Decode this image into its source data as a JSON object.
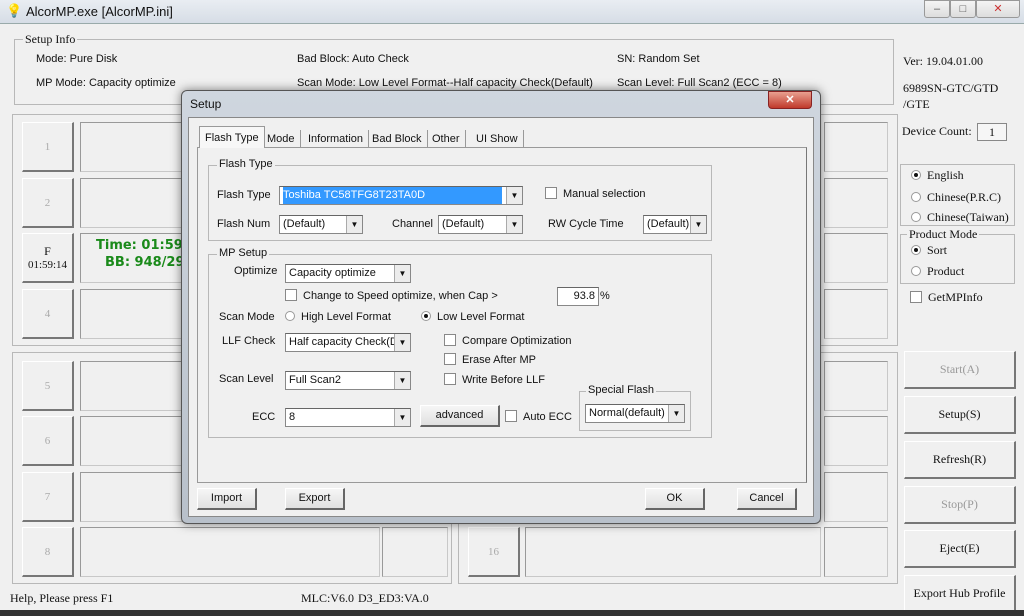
{
  "window": {
    "title": "AlcorMP.exe [AlcorMP.ini]",
    "minimize": "–",
    "maximize": "□",
    "close": "✕",
    "app_icon": "lightbulb-icon"
  },
  "setup_info": {
    "label": "Setup Info",
    "mode": "Mode: Pure Disk",
    "mp_mode": "MP Mode: Capacity optimize",
    "bad_block": "Bad Block: Auto Check",
    "scan_mode": "Scan Mode: Low Level Format--Half capacity Check(Default)",
    "sn": "SN: Random Set",
    "scan_level": "Scan Level: Full Scan2 (ECC = 8)"
  },
  "version": {
    "ver": "Ver: 19.04.01.00",
    "chip": "6989SN-GTC/GTD /GTE"
  },
  "device_count": {
    "label": "Device Count:",
    "value": "1"
  },
  "language": {
    "options": [
      {
        "label": "English",
        "selected": true
      },
      {
        "label": "Chinese(P.R.C)",
        "selected": false
      },
      {
        "label": "Chinese(Taiwan)",
        "selected": false
      }
    ]
  },
  "product_mode": {
    "label": "Product Mode",
    "options": [
      {
        "label": "Sort",
        "selected": true
      },
      {
        "label": "Product",
        "selected": false
      }
    ]
  },
  "get_mp_info": {
    "label": "GetMPInfo",
    "checked": false
  },
  "actions": {
    "start": "Start(A)",
    "setup": "Setup(S)",
    "refresh": "Refresh(R)",
    "stop": "Stop(P)",
    "eject": "Eject(E)",
    "export_hub": "Export Hub Profile"
  },
  "slots_left": [
    {
      "label": "1",
      "sub": "",
      "active": false,
      "info1": "",
      "info2": ""
    },
    {
      "label": "2",
      "sub": "",
      "active": false,
      "info1": "",
      "info2": ""
    },
    {
      "label": "F",
      "sub": "01:59:14",
      "active": true,
      "info1": "Time: 01:59:1",
      "info2": "BB: 948/29"
    },
    {
      "label": "4",
      "sub": "",
      "active": false,
      "info1": "",
      "info2": ""
    },
    {
      "label": "5",
      "sub": "",
      "active": false,
      "info1": "",
      "info2": ""
    },
    {
      "label": "6",
      "sub": "",
      "active": false,
      "info1": "",
      "info2": ""
    },
    {
      "label": "7",
      "sub": "",
      "active": false,
      "info1": "",
      "info2": ""
    },
    {
      "label": "8",
      "sub": "",
      "active": false,
      "info1": "",
      "info2": ""
    }
  ],
  "slot_16": {
    "label": "16"
  },
  "status": {
    "help": "Help, Please press F1",
    "mlc": "MLC:V6.0",
    "d3": "D3_ED3:VA.0"
  },
  "dialog": {
    "title": "Setup",
    "close": "✕",
    "tabs": [
      {
        "label": "Flash Type",
        "selected": true
      },
      {
        "label": "Mode"
      },
      {
        "label": "Information"
      },
      {
        "label": "Bad Block"
      },
      {
        "label": "Other"
      },
      {
        "label": "UI Show"
      }
    ],
    "flash_group": "Flash Type",
    "flash_type_label": "Flash Type",
    "flash_type_value": "Toshiba TC58TFG8T23TA0D",
    "manual_selection": "Manual selection",
    "flash_num_label": "Flash Num",
    "flash_num_value": "(Default)",
    "channel_label": "Channel",
    "channel_value": "(Default)",
    "rw_cycle_label": "RW Cycle Time",
    "rw_cycle_value": "(Default)",
    "mp_group": "MP Setup",
    "optimize_label": "Optimize",
    "optimize_value": "Capacity optimize",
    "speed_opt": "Change to Speed optimize, when Cap  >",
    "cap_value": "93.8",
    "cap_unit": "%",
    "scan_mode_label": "Scan Mode",
    "high_level": "High Level Format",
    "low_level": "Low Level Format",
    "scan_mode_selected": "Low Level Format",
    "llf_check_label": "LLF Check",
    "llf_check_value": "Half capacity Check(Default)",
    "compare_opt": "Compare Optimization",
    "erase_after": "Erase After MP",
    "write_before": "Write Before LLF",
    "scan_level_label": "Scan Level",
    "scan_level_value": "Full Scan2",
    "ecc_label": "ECC",
    "ecc_value": "8",
    "advanced": "advanced",
    "auto_ecc": "Auto ECC",
    "special_flash_group": "Special Flash",
    "special_flash_value": "Normal(default)",
    "import": "Import",
    "export": "Export",
    "ok": "OK",
    "cancel": "Cancel"
  },
  "colors": {
    "accent_selection": "#3399ff",
    "status_green": "#1a8a1a",
    "close_red": "#c0392b"
  }
}
